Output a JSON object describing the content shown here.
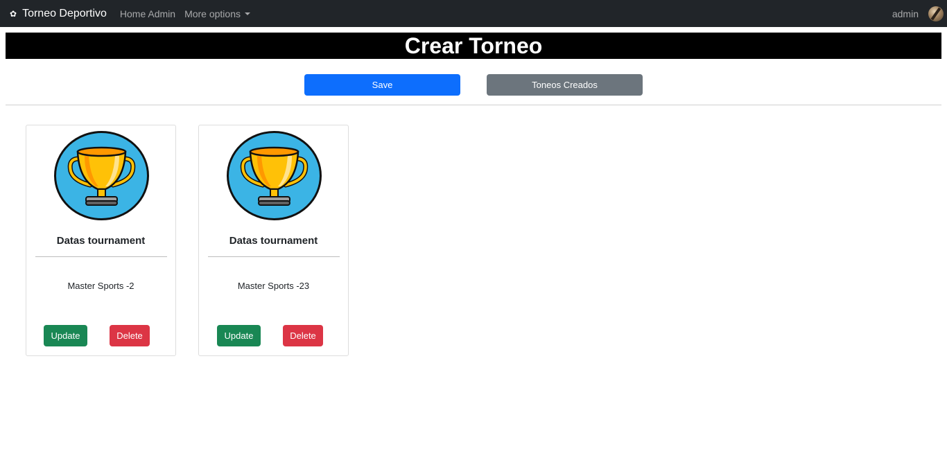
{
  "navbar": {
    "brand_icon": "flower-icon",
    "brand": "Torneo Deportivo",
    "home": "Home Admin",
    "more": "More options",
    "user": "admin",
    "background": "#212529"
  },
  "page": {
    "title": "Crear Torneo"
  },
  "actions": {
    "save": "Save",
    "created": "Toneos Creados",
    "save_color": "#0d6efd",
    "created_color": "#6c757d"
  },
  "cards": [
    {
      "icon": "trophy-icon",
      "title": "Datas tournament",
      "text": "Master Sports -2",
      "update": "Update",
      "delete": "Delete"
    },
    {
      "icon": "trophy-icon",
      "title": "Datas tournament",
      "text": "Master Sports -23",
      "update": "Update",
      "delete": "Delete"
    }
  ],
  "colors": {
    "update": "#198754",
    "delete": "#dc3545",
    "trophy_bg": "#3bb4e5",
    "trophy_gold": "#ffc107"
  }
}
